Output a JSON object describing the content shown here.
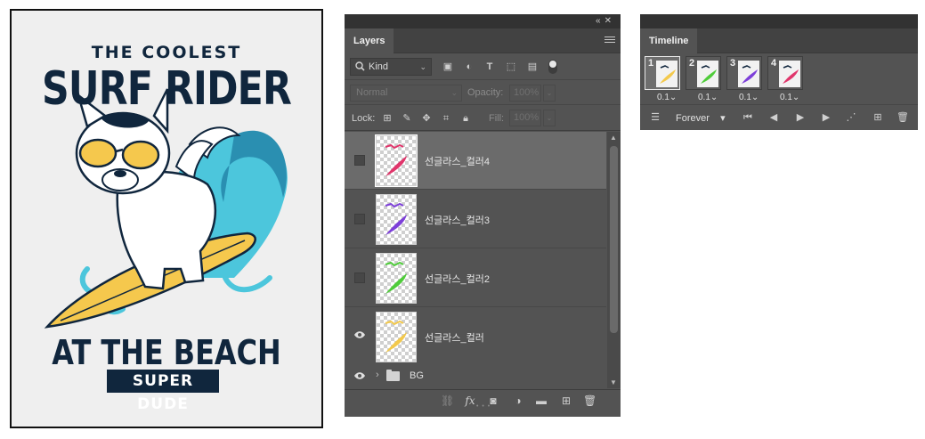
{
  "poster": {
    "line1": "THE COOLEST",
    "line2": "SURF RIDER",
    "line3": "AT THE BEACH",
    "badge": "SUPER DUDE"
  },
  "layers_panel": {
    "tab_label": "Layers",
    "filter": {
      "kind_label": "Kind"
    },
    "blend_mode": "Normal",
    "opacity_label": "Opacity:",
    "opacity_value": "100%",
    "lock_label": "Lock:",
    "fill_label": "Fill:",
    "fill_value": "100%",
    "layers": [
      {
        "name": "선글라스_컬러4",
        "visible": false,
        "selected": true,
        "color": "#e0356b"
      },
      {
        "name": "선글라스_컬러3",
        "visible": false,
        "selected": false,
        "color": "#7d3fd9"
      },
      {
        "name": "선글라스_컬러2",
        "visible": false,
        "selected": false,
        "color": "#4fcc3a"
      },
      {
        "name": "선글라스_컬러",
        "visible": true,
        "selected": false,
        "color": "#f3c94c"
      }
    ],
    "group": {
      "name": "BG",
      "visible": true
    }
  },
  "timeline_panel": {
    "tab_label": "Timeline",
    "frames": [
      {
        "number": "1",
        "delay": "0.1",
        "selected": true,
        "color": "#f3c94c"
      },
      {
        "number": "2",
        "delay": "0.1",
        "selected": false,
        "color": "#4fcc3a"
      },
      {
        "number": "3",
        "delay": "0.1",
        "selected": false,
        "color": "#7d3fd9"
      },
      {
        "number": "4",
        "delay": "0.1",
        "selected": false,
        "color": "#e0356b"
      }
    ],
    "loop": "Forever"
  }
}
